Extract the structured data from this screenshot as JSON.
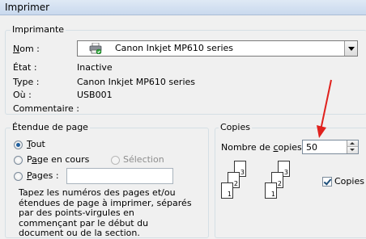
{
  "window": {
    "title": "Imprimer"
  },
  "printer_group": {
    "legend": "Imprimante",
    "name_label": "Nom :",
    "name_value": "Canon Inkjet MP610 series",
    "status_label": "État :",
    "status_value": "Inactive",
    "type_label": "Type :",
    "type_value": "Canon Inkjet MP610 series",
    "where_label": "Où :",
    "where_value": "USB001",
    "comment_label": "Commentaire :",
    "comment_value": ""
  },
  "page_range": {
    "legend": "Étendue de page",
    "all_label": "Tout",
    "current_label": "Page en cours",
    "selection_label": "Sélection",
    "pages_label": "Pages :",
    "pages_value": "",
    "help_text": "Tapez les numéros des pages et/ou étendues de page à imprimer, séparés par des points-virgules en commençant par le début du document ou de la section.",
    "selected": "all"
  },
  "copies": {
    "legend": "Copies",
    "count_label": "Nombre de copies :",
    "count_value": "50",
    "collate_label": "Copies a",
    "collate_checked": true,
    "collate_pages": [
      "1",
      "2",
      "3"
    ]
  },
  "colors": {
    "arrow": "#e0211d",
    "titlebar": "#c9d9ee"
  }
}
